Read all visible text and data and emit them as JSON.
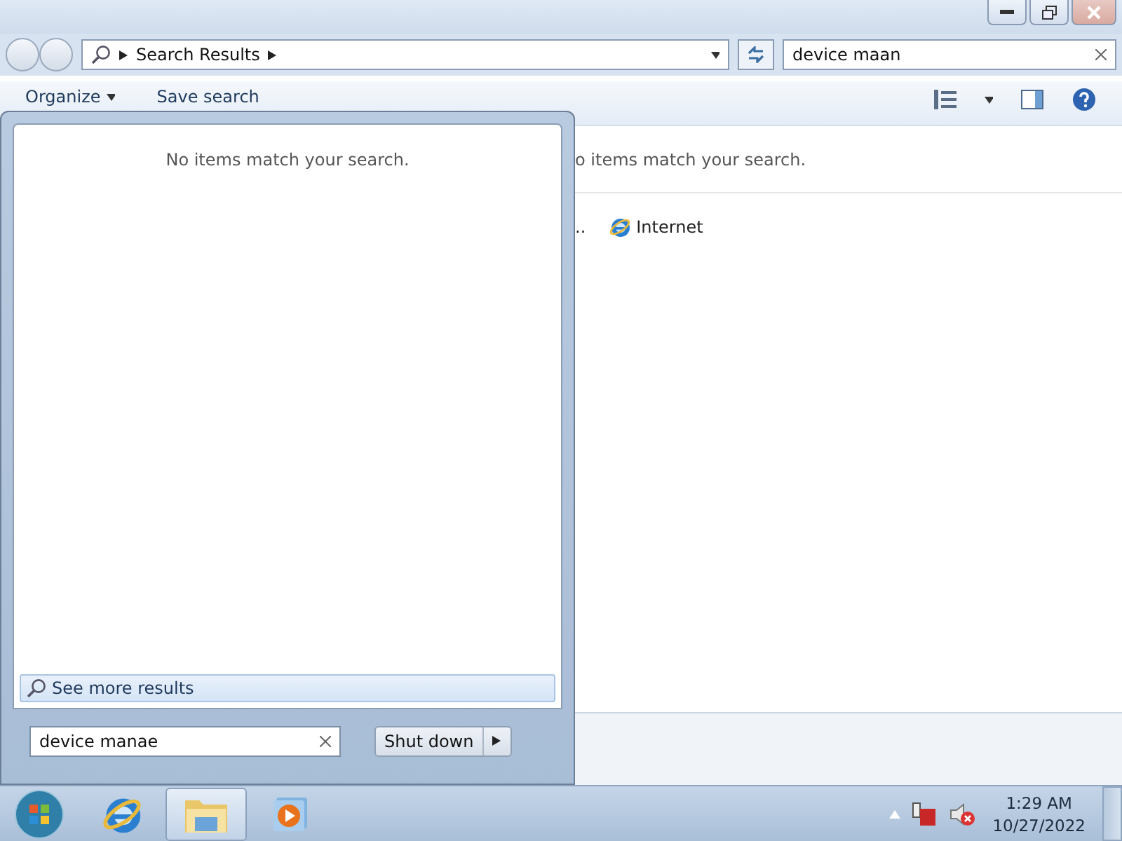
{
  "explorer": {
    "address": {
      "crumb": "Search Results"
    },
    "search": {
      "value": "device maan"
    },
    "toolbar": [
      {
        "label": "Organize",
        "kind": "menu"
      },
      {
        "label": "Save search",
        "kind": "button"
      }
    ],
    "message": "o items match your search.",
    "search_again": [
      {
        "label": "..",
        "kind": "text"
      },
      {
        "label": "Internet",
        "kind": "ie"
      }
    ]
  },
  "start_menu": {
    "message": "No items match your search.",
    "see_more": "See more results",
    "search": {
      "value": "device manae"
    },
    "shutdown": "Shut down"
  },
  "taskbar": {
    "apps": [
      {
        "kind": "ie",
        "selected": false
      },
      {
        "kind": "explorer",
        "selected": true
      },
      {
        "kind": "media",
        "selected": false
      }
    ],
    "clock": {
      "time": "1:29 AM",
      "date": "10/27/2022"
    }
  }
}
